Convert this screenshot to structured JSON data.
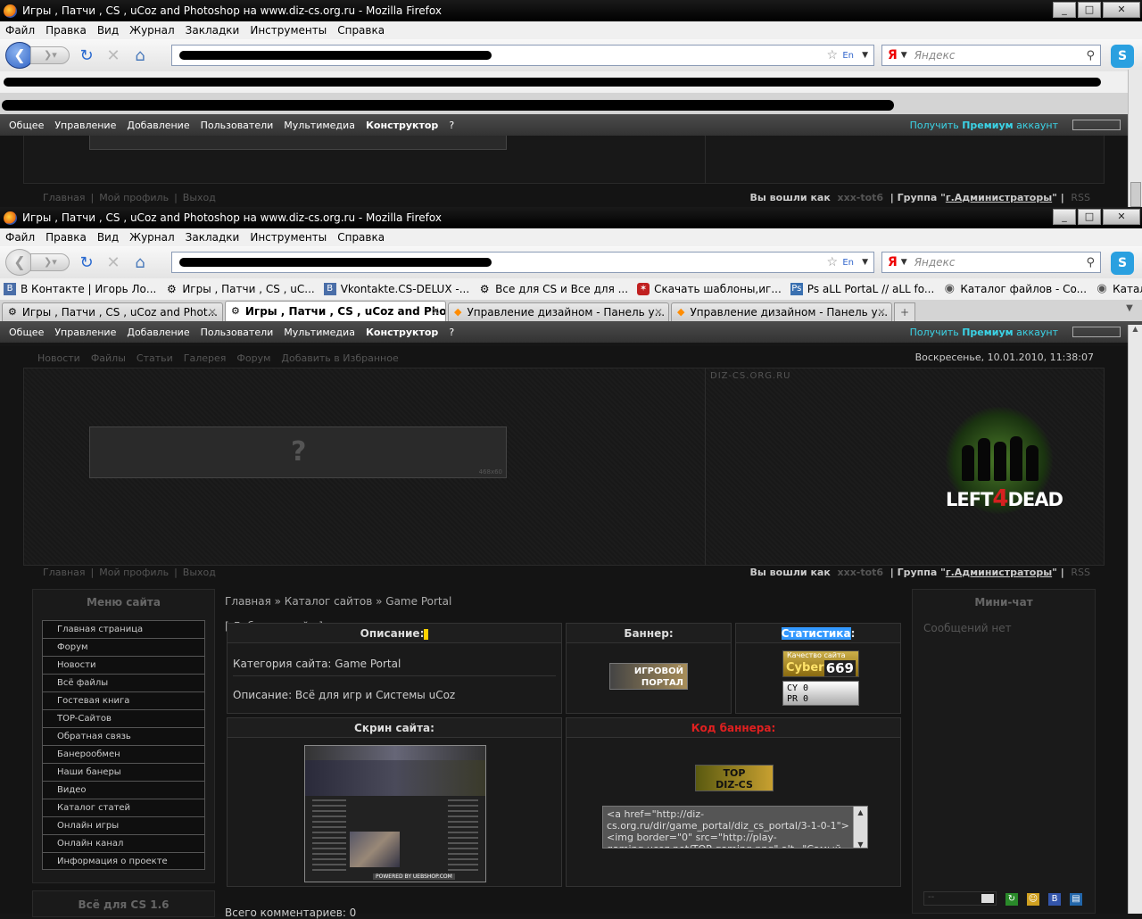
{
  "window": {
    "title": "Игры , Патчи , CS , uCoz and Photoshop на www.diz-cs.org.ru - Mozilla Firefox",
    "buttons": [
      "_",
      "□",
      "✕"
    ]
  },
  "menu": [
    "Файл",
    "Правка",
    "Вид",
    "Журнал",
    "Закладки",
    "Инструменты",
    "Справка"
  ],
  "toolbar": {
    "search_placeholder": "Яндекс",
    "search_engine": "Я",
    "lang": "En"
  },
  "bookmarks": [
    {
      "icon": "vk-icon",
      "label": "В Контакте | Игорь Ло..."
    },
    {
      "icon": "cs-icon",
      "label": "Игры , Патчи , CS , uC..."
    },
    {
      "icon": "vk-icon",
      "label": "Vkontakte.CS-DELUX -..."
    },
    {
      "icon": "cs-icon",
      "label": "Все для CS и Все для ..."
    },
    {
      "icon": "fire-icon",
      "label": "Скачать шаблоны,иг..."
    },
    {
      "icon": "ps-icon",
      "label": "Ps aLL PortaL // aLL fo..."
    },
    {
      "icon": "catalog-icon",
      "label": "Каталог файлов - Co..."
    },
    {
      "icon": "catalog-icon",
      "label": "Каталог файлов - Ga..."
    }
  ],
  "tabs": [
    {
      "label": "Игры , Патчи , CS , uCoz and Phot...",
      "active": false
    },
    {
      "label": "Игры , Патчи , CS , uCoz and Phot...",
      "active": true
    },
    {
      "label": "Управление дизайном - Панель у...",
      "active": false
    },
    {
      "label": "Управление дизайном - Панель у...",
      "active": false
    }
  ],
  "adminbar": {
    "items": [
      "Общее",
      "Управление",
      "Добавление",
      "Пользователи",
      "Мультимедиа",
      "Конструктор",
      "?"
    ],
    "premium_pre": "Получить ",
    "premium_bold": "Премиум",
    "premium_post": " аккаунт"
  },
  "sitenav": [
    "Новости",
    "Файлы",
    "Статьи",
    "Галерея",
    "Форум",
    "Добавить в Избранное"
  ],
  "date": "Воскресенье, 10.01.2010, 11:38:07",
  "header": {
    "banner_mark": "?",
    "banner_size": "468x60",
    "domain": "DIZ-CS.ORG.RU",
    "logo_pre": "LEFT",
    "logo_num": "4",
    "logo_post": "DEAD"
  },
  "loginbar": {
    "links": [
      "Главная",
      "Мой профиль",
      "Выход"
    ],
    "logged_as": "Вы вошли как",
    "user": "xxx-tot6",
    "group_label": "| Группа \"",
    "group": "г.Администраторы",
    "group_end": "\" |",
    "rss": "RSS"
  },
  "sidebar": {
    "title": "Меню сайта",
    "items": [
      "Главная страница",
      "Форум",
      "Новости",
      "Всё файлы",
      "Гостевая книга",
      "TOP-Сайтов",
      "Обратная связь",
      "Банерообмен",
      "Наши банеры",
      "Видео",
      "Каталог статей",
      "Онлайн игры",
      "Онлайн канал",
      "Информация о проекте"
    ],
    "title2": "Всё для CS 1.6"
  },
  "content": {
    "crumbs": "Главная » Каталог сайтов » Game Portal",
    "add_site": "[ Добавить сайт ]",
    "desc_head": "Описание:",
    "banner_head": "Баннер:",
    "stats_head": "Статистика",
    "stats_colon": ":",
    "category": "Категория сайта: Game Portal",
    "description": "Описание: Всё для игр и Системы uCoz",
    "site_banner_l1": "ИГРОВОЙ",
    "site_banner_l2": "ПОРТАЛ",
    "cyber_title": "Качество сайта",
    "cyber_word": "Cyber",
    "cyber_num": "669",
    "cy": "CY 0",
    "pr": "PR 0",
    "screen_head": "Скрин сайта:",
    "screen_footer": "POWERED BY UEBSHOP.COM",
    "code_head": "Код баннера:",
    "top_l1": "TOP",
    "top_l2": "DIZ-CS",
    "code": "<a href=\"http://diz-cs.org.ru/dir/game_portal/diz_cs_portal/3-1-0-1\"><img border=\"0\" src=\"http://play-gaming.ucoz.net/TOP-gaming.png\" alt=\"Самый лучший игровой",
    "total_comments": "Всего комментариев: 0"
  },
  "minichat": {
    "title": "Мини-чат",
    "empty": "Сообщений нет",
    "select": "--"
  }
}
